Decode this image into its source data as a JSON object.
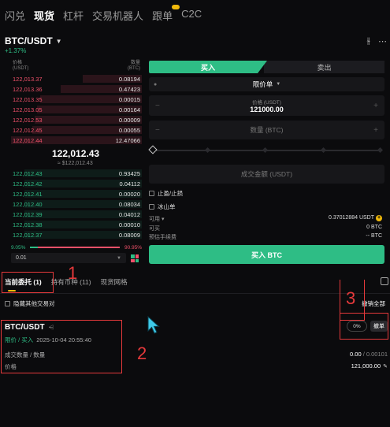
{
  "nav": {
    "tabs": [
      "闪兑",
      "现货",
      "杠杆",
      "交易机器人",
      "跟单",
      "C2C"
    ],
    "active_tab": "现货"
  },
  "pair": {
    "name": "BTC/USDT",
    "change": "+1.37%"
  },
  "orderbook": {
    "price_label": "价格",
    "price_unit": "(USDT)",
    "qty_label": "数量",
    "qty_unit": "(BTC)",
    "asks": [
      {
        "price": "122,013.37",
        "qty": "0.08194",
        "depth": 0.45
      },
      {
        "price": "122,013.36",
        "qty": "0.47423",
        "depth": 0.62
      },
      {
        "price": "122,013.35",
        "qty": "0.00015",
        "depth": 0.78
      },
      {
        "price": "122,013.05",
        "qty": "0.00164",
        "depth": 0.8
      },
      {
        "price": "122,012.53",
        "qty": "0.00009",
        "depth": 0.82
      },
      {
        "price": "122,012.45",
        "qty": "0.00055",
        "depth": 0.84
      },
      {
        "price": "122,012.44",
        "qty": "12.47066",
        "depth": 1.0
      }
    ],
    "mid_price": "122,012.43",
    "mid_fiat": "≈ $122,012.43",
    "bids": [
      {
        "price": "122,012.43",
        "qty": "0.93425",
        "depth": 0.9
      },
      {
        "price": "122,012.42",
        "qty": "0.04112",
        "depth": 0.9
      },
      {
        "price": "122,012.41",
        "qty": "0.00020",
        "depth": 0.9
      },
      {
        "price": "122,012.40",
        "qty": "0.08034",
        "depth": 0.9
      },
      {
        "price": "122,012.39",
        "qty": "0.04012",
        "depth": 0.9
      },
      {
        "price": "122,012.38",
        "qty": "0.00010",
        "depth": 0.9
      },
      {
        "price": "122,012.37",
        "qty": "0.08009",
        "depth": 0.9
      }
    ],
    "buy_ratio": "9.05%",
    "sell_ratio": "90.95%",
    "buy_ratio_value": 0.0905,
    "precision": "0.01"
  },
  "trade": {
    "buy_tab": "买入",
    "sell_tab": "卖出",
    "order_type": "限价单",
    "price_label": "价格 (USDT)",
    "price_value": "121000.00",
    "qty_placeholder": "数量 (BTC)",
    "amount_placeholder": "成交金额 (USDT)",
    "tp_sl": "止盈/止损",
    "iceberg": "冰山单",
    "available_label": "可用",
    "available_value": "0.37012884 USDT",
    "buyable_label": "可买",
    "buyable_value": "0 BTC",
    "fee_label": "预估手续费",
    "fee_value": "-- BTC",
    "buy_button": "买入 BTC"
  },
  "orders": {
    "tabs": [
      "当前委托 (1)",
      "持有币种 (11)",
      "现货网格"
    ],
    "hide_other": "隐藏其他交易对",
    "cancel_all": "撤销全部",
    "item": {
      "pair": "BTC/USDT",
      "type": "限价 / 买入",
      "time": "2025-10-04 20:55:40",
      "filled_label": "成交数量 / 数量",
      "filled_value": "0.00",
      "filled_total": " / 0.00101",
      "price_label": "价格",
      "price_value": "121,000.00",
      "progress": "0%",
      "cancel": "撤单"
    }
  },
  "annotations": [
    "1",
    "2",
    "3"
  ],
  "colors": {
    "buy": "#2ebd85",
    "sell": "#f0516a",
    "accent": "#f0b90b",
    "annotation": "#e5393b"
  }
}
